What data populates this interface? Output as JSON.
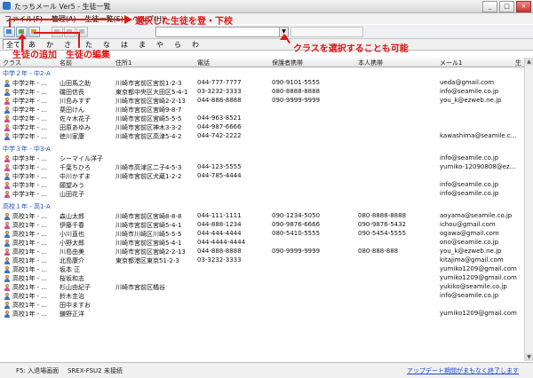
{
  "window": {
    "title": "たっちメール Ver5 - 生徒一覧"
  },
  "menu": [
    "ファイル(F)",
    "管理(A)",
    "生徒一覧(S)",
    "ヘルプ(H)"
  ],
  "kana_tabs": [
    "全て",
    "あ",
    "か",
    "さ",
    "た",
    "な",
    "は",
    "ま",
    "や",
    "ら",
    "わ"
  ],
  "columns": [
    "クラス",
    "名前",
    "住所1",
    "電話",
    "保護者携帯",
    "本人携帯",
    "メール1",
    "生"
  ],
  "groups": [
    {
      "label": "中学２年 - 中2-A",
      "rows": [
        {
          "cls": "中学2年 - ...",
          "name": "山田馬之助",
          "addr": "川崎市宮前区宮前1-2-3",
          "tel": "044-777-7777",
          "p": "090-9101-5555",
          "s": "",
          "mail": "ueda@gmail.com",
          "g": "m"
        },
        {
          "cls": "中学2年 - ...",
          "name": "磯田信長",
          "addr": "東京都中央区大田区5-4-1",
          "tel": "03-3232-3333",
          "p": "080-8888-8888",
          "s": "",
          "mail": "info@seamile.co.jp",
          "g": "m"
        },
        {
          "cls": "中学2年 - ...",
          "name": "川島みすず",
          "addr": "川崎市宮前区宮崎2-2-13",
          "tel": "044-888-8888",
          "p": "090-9999-9999",
          "s": "",
          "mail": "you_k@ezweb.ne.jp",
          "g": "f"
        },
        {
          "cls": "中学2年 - ...",
          "name": "栗田けん",
          "addr": "川崎市宮前区宮崎9-8-7",
          "tel": "",
          "p": "",
          "s": "",
          "mail": "",
          "g": "m"
        },
        {
          "cls": "中学2年 - ...",
          "name": "佐々木花子",
          "addr": "川崎市宮前区宮崎5-5-5",
          "tel": "044-963-8521",
          "p": "",
          "s": "",
          "mail": "",
          "g": "f"
        },
        {
          "cls": "中学2年 - ...",
          "name": "田原あゆみ",
          "addr": "川崎市宮前区神木3-3-2",
          "tel": "044-987-6666",
          "p": "",
          "s": "",
          "mail": "",
          "g": "f"
        },
        {
          "cls": "中学2年 - ...",
          "name": "徳川家康",
          "addr": "川崎市宮前区高津5-4-2",
          "tel": "044-742-2222",
          "p": "",
          "s": "",
          "mail": "kawashima@seamile.c...",
          "g": "m"
        }
      ]
    },
    {
      "label": "中学３年 - 中3-A",
      "rows": [
        {
          "cls": "中学3年 - ...",
          "name": "シーマイル洋子",
          "addr": "",
          "tel": "",
          "p": "",
          "s": "",
          "mail": "info@seamile.co.jp",
          "g": "f"
        },
        {
          "cls": "中学3年 - ...",
          "name": "千葉ちひろ",
          "addr": "川崎市高津区二子4-5-3",
          "tel": "044-123-5555",
          "p": "",
          "s": "",
          "mail": "yumiko-12090808@ez...",
          "g": "f"
        },
        {
          "cls": "中学3年 - ...",
          "name": "中川かずま",
          "addr": "川崎市宮前区犬蔵1-2-2",
          "tel": "044-785-4444",
          "p": "",
          "s": "",
          "mail": "",
          "g": "m"
        },
        {
          "cls": "中学3年 - ...",
          "name": "願望みう",
          "addr": "",
          "tel": "",
          "p": "",
          "s": "",
          "mail": "info@seamile.co.jp",
          "g": "f"
        },
        {
          "cls": "中学3年 - ...",
          "name": "山田花子",
          "addr": "",
          "tel": "",
          "p": "",
          "s": "",
          "mail": "info@seamile.co.jp",
          "g": "f"
        }
      ]
    },
    {
      "label": "高校１年 - 高1-A",
      "rows": [
        {
          "cls": "高校1年 - ...",
          "name": "森山太郎",
          "addr": "川崎市宮前区宮崎8-8-8",
          "tel": "044-111-1111",
          "p": "090-1234-5050",
          "s": "080-8888-8888",
          "mail": "aoyama@seamile.co.jp",
          "g": "m"
        },
        {
          "cls": "高校1年 - ...",
          "name": "伊藤千春",
          "addr": "川崎市宮前区宮崎5-4-1",
          "tel": "044-888-1234",
          "p": "090-9876-6666",
          "s": "090-9876-5432",
          "mail": "ichou@gmail.com",
          "g": "f"
        },
        {
          "cls": "高校1年 - ...",
          "name": "小川直也",
          "addr": "川崎市川崎区川崎5-5-5",
          "tel": "044-444-4444",
          "p": "080-5410-5555",
          "s": "090-5454-5555",
          "mail": "ogawa@gmail.com",
          "g": "m"
        },
        {
          "cls": "高校1年 - ...",
          "name": "小野太郎",
          "addr": "川崎市宮前区宮崎5-4-1",
          "tel": "044-4444-4444",
          "p": "",
          "s": "",
          "mail": "ono@seamile.co.jp",
          "g": "m"
        },
        {
          "cls": "高校1年 - ...",
          "name": "川島由美",
          "addr": "川崎市宮前区宮崎2-2-13",
          "tel": "044-888-8888",
          "p": "090-9999-9999",
          "s": "080-888-888",
          "mail": "you_k@ezweb.ne.jp",
          "g": "f"
        },
        {
          "cls": "高校1年 - ...",
          "name": "北島康介",
          "addr": "東京都港区東京51-2-3",
          "tel": "03-3232-3333",
          "p": "",
          "s": "",
          "mail": "kitajima@gmail.com",
          "g": "m"
        },
        {
          "cls": "高校1年 - ...",
          "name": "坂本 正",
          "addr": "",
          "tel": "",
          "p": "",
          "s": "",
          "mail": "yumiko1209@gmail.com",
          "g": "m"
        },
        {
          "cls": "高校1年 - ...",
          "name": "桜坂和志",
          "addr": "",
          "tel": "",
          "p": "",
          "s": "",
          "mail": "yumiko1209@gmail.com",
          "g": "m"
        },
        {
          "cls": "高校1年 - ...",
          "name": "杉山由紀子",
          "addr": "川崎市宮前区橘谷",
          "tel": "",
          "p": "",
          "s": "",
          "mail": "yukiko@seamile.co.jp",
          "g": "f"
        },
        {
          "cls": "高校1年 - ...",
          "name": "鈴木圭治",
          "addr": "",
          "tel": "",
          "p": "",
          "s": "",
          "mail": "info@seamile.co.jp",
          "g": "m"
        },
        {
          "cls": "高校1年 - ...",
          "name": "田中ますお",
          "addr": "",
          "tel": "",
          "p": "",
          "s": "",
          "mail": "",
          "g": "m"
        },
        {
          "cls": "高校1年 - ...",
          "name": "鎌野正洋",
          "addr": "",
          "tel": "",
          "p": "",
          "s": "",
          "mail": "yumiko1209@gmail.com",
          "g": "m"
        }
      ]
    }
  ],
  "annotations": {
    "select_school": "選択した生徒を登・下校",
    "add_student": "生徒の追加",
    "edit_student": "生徒の編集",
    "select_class": "クラスを選択することも可能"
  },
  "status": {
    "left": "F5: 入退場画面",
    "mid": "SREX-FSU2 未接続",
    "right": "アップデート期間がまもなく終了します"
  },
  "colors": {
    "annotation": "#e01616",
    "group": "#1f4fbf",
    "link": "#1c49d6"
  }
}
